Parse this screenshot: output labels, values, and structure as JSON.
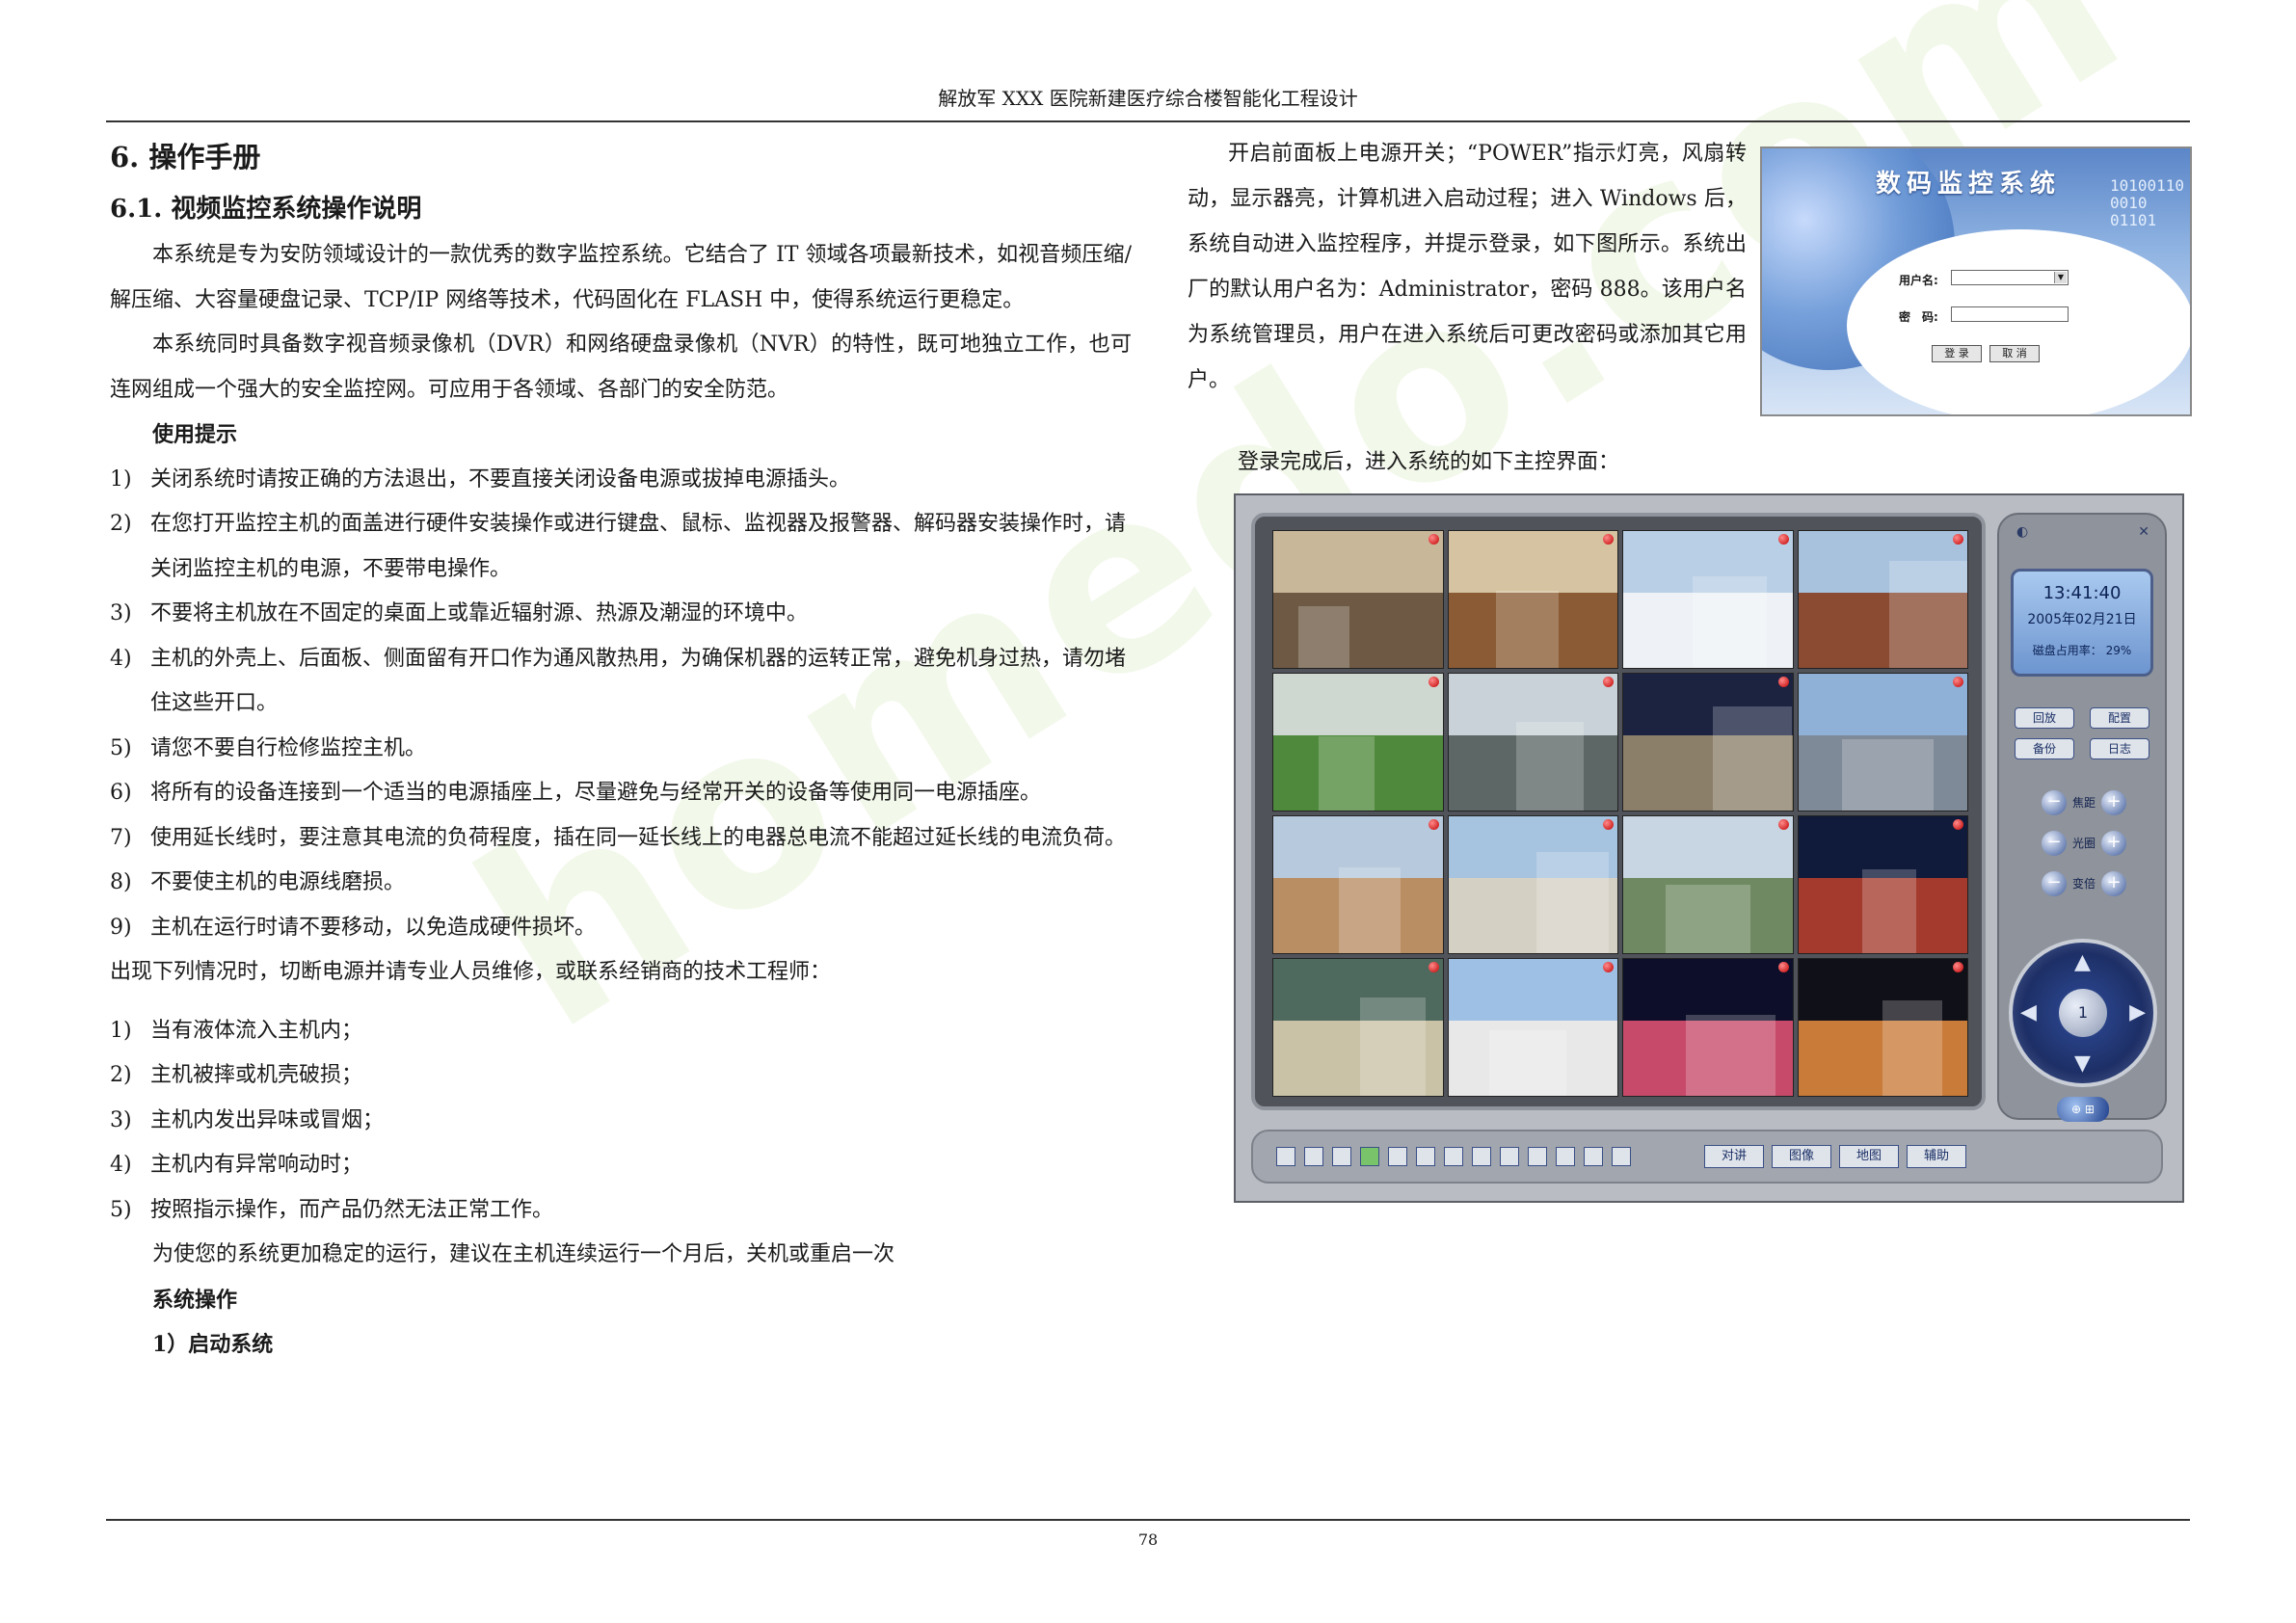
{
  "header": {
    "title": "解放军 XXX 医院新建医疗综合楼智能化工程设计"
  },
  "footer": {
    "page_number": "78"
  },
  "watermark": {
    "text": "homedo.com"
  },
  "left": {
    "h1": "6. 操作手册",
    "h2": "6.1. 视频监控系统操作说明",
    "para1": "本系统是专为安防领域设计的一款优秀的数字监控系统。它结合了 IT 领域各项最新技术，如视音频压缩/解压缩、大容量硬盘记录、TCP/IP 网络等技术，代码固化在 FLASH 中，使得系统运行更稳定。",
    "para2": "本系统同时具备数字视音频录像机（DVR）和网络硬盘录像机（NVR）的特性，既可地独立工作，也可连网组成一个强大的安全监控网。可应用于各领域、各部门的安全防范。",
    "tips_title": "使用提示",
    "tips": [
      {
        "num": "1)",
        "text": "关闭系统时请按正确的方法退出，不要直接关闭设备电源或拔掉电源插头。"
      },
      {
        "num": "2)",
        "text": "在您打开监控主机的面盖进行硬件安装操作或进行键盘、鼠标、监视器及报警器、解码器安装操作时，请关闭监控主机的电源，不要带电操作。"
      },
      {
        "num": "3)",
        "text": "不要将主机放在不固定的桌面上或靠近辐射源、热源及潮湿的环境中。"
      },
      {
        "num": "4)",
        "text": "主机的外壳上、后面板、侧面留有开口作为通风散热用，为确保机器的运转正常，避免机身过热，请勿堵住这些开口。"
      },
      {
        "num": "5)",
        "text": "请您不要自行检修监控主机。"
      },
      {
        "num": "6)",
        "text": "将所有的设备连接到一个适当的电源插座上，尽量避免与经常开关的设备等使用同一电源插座。"
      },
      {
        "num": "7)",
        "text": "使用延长线时，要注意其电流的负荷程度，插在同一延长线上的电器总电流不能超过延长线的电流负荷。"
      },
      {
        "num": "8)",
        "text": "不要使主机的电源线磨损。"
      },
      {
        "num": "9)",
        "text": "主机在运行时请不要移动，以免造成硬件损坏。"
      }
    ],
    "repair_intro": "出现下列情况时，切断电源并请专业人员维修，或联系经销商的技术工程师：",
    "repair": [
      {
        "num": "1)",
        "text": "当有液体流入主机内；"
      },
      {
        "num": "2)",
        "text": "主机被摔或机壳破损；"
      },
      {
        "num": "3)",
        "text": "主机内发出异味或冒烟；"
      },
      {
        "num": "4)",
        "text": "主机内有异常响动时；"
      },
      {
        "num": "5)",
        "text": "按照指示操作，而产品仍然无法正常工作。"
      }
    ],
    "advice": "为使您的系统更加稳定的运行，建议在主机连续运行一个月后，关机或重启一次",
    "sys_op_title": "系统操作",
    "start_title": "1）启动系统"
  },
  "right": {
    "para": "开启前面板上电源开关；“POWER”指示灯亮，风扇转动，显示器亮，计算机进入启动过程；进入 Windows 后，系统自动进入监控程序，并提示登录，如下图所示。系统出厂的默认用户名为：Administrator，密码 888。该用户名为系统管理员，用户在进入系统后可更改密码或添加其它用户。",
    "caption": "登录完成后，进入系统的如下主控界面："
  },
  "login": {
    "title": "数码监控系统",
    "digits": "10100110\n0010\n01101",
    "user_label": "用户名:",
    "pass_label": "密　码:",
    "login_btn": "登 录",
    "cancel_btn": "取 消"
  },
  "console": {
    "time": "13:41:40",
    "date": "2005年02月21日",
    "disk": "磁盘占用率： 29%",
    "side_buttons": [
      "回放",
      "配置",
      "备份",
      "日志"
    ],
    "adjust": [
      "焦距",
      "光圈",
      "变倍"
    ],
    "joystick_center": "1",
    "toolbar_text": [
      "对讲",
      "图像",
      "地图",
      "辅助"
    ],
    "colors": {
      "panel": "#b9bcc3",
      "accent": "#2f4c99",
      "alarm_dot": "#c00000"
    }
  }
}
